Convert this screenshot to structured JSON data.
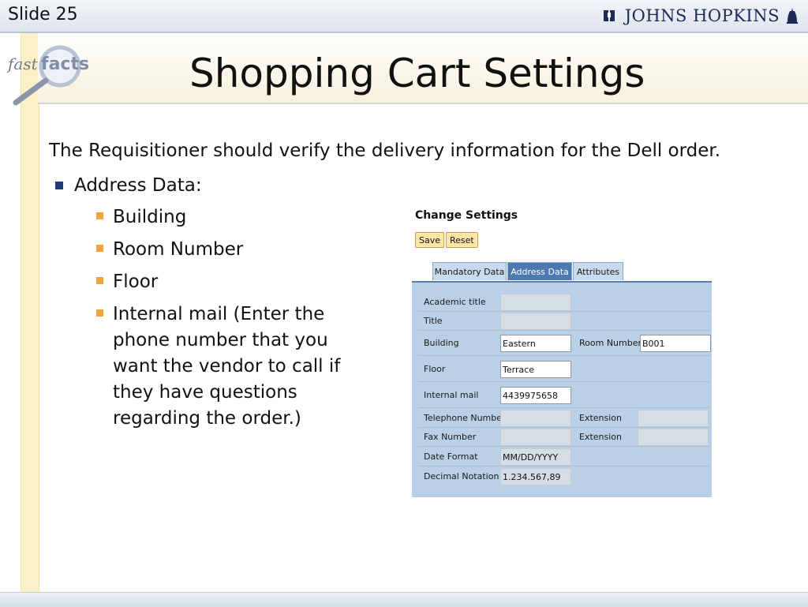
{
  "header": {
    "slide_label": "Slide 25",
    "brand_text": "JOHNS HOPKINS"
  },
  "logo": {
    "word1": "fast",
    "word2": "facts"
  },
  "title": "Shopping Cart Settings",
  "intro": "The Requisitioner should verify the delivery information for the Dell order.",
  "bullets": {
    "main": "Address Data:",
    "subs": [
      "Building",
      "Room Number",
      "Floor",
      "Internal mail (Enter the phone number that you want the vendor to call if they have questions regarding the order.)"
    ]
  },
  "screenshot": {
    "heading": "Change Settings",
    "save_label": "Save",
    "reset_label": "Reset",
    "tabs": [
      "Mandatory Data",
      "Address Data",
      "Attributes"
    ],
    "active_tab": "Address Data",
    "fields": {
      "academic_title": {
        "label": "Academic title",
        "value": ""
      },
      "title": {
        "label": "Title",
        "value": ""
      },
      "building": {
        "label": "Building",
        "value": "Eastern"
      },
      "room_number": {
        "label": "Room Number",
        "value": "B001"
      },
      "floor": {
        "label": "Floor",
        "value": "Terrace"
      },
      "internal_mail": {
        "label": "Internal mail",
        "value": "4439975658"
      },
      "telephone": {
        "label": "Telephone Number",
        "value": ""
      },
      "telephone_ext": {
        "label": "Extension",
        "value": ""
      },
      "fax": {
        "label": "Fax Number",
        "value": ""
      },
      "fax_ext": {
        "label": "Extension",
        "value": ""
      },
      "date_format": {
        "label": "Date Format",
        "value": "MM/DD/YYYY"
      },
      "decimal_notation": {
        "label": "Decimal Notation",
        "value": "1.234.567,89"
      }
    }
  },
  "colors": {
    "bullet_main": "#1f3a78",
    "bullet_sub": "#f2a53a",
    "panel_bg": "#b9d0e6",
    "active_tab": "#4b79b0",
    "button_bg": "#fbe6a8"
  }
}
